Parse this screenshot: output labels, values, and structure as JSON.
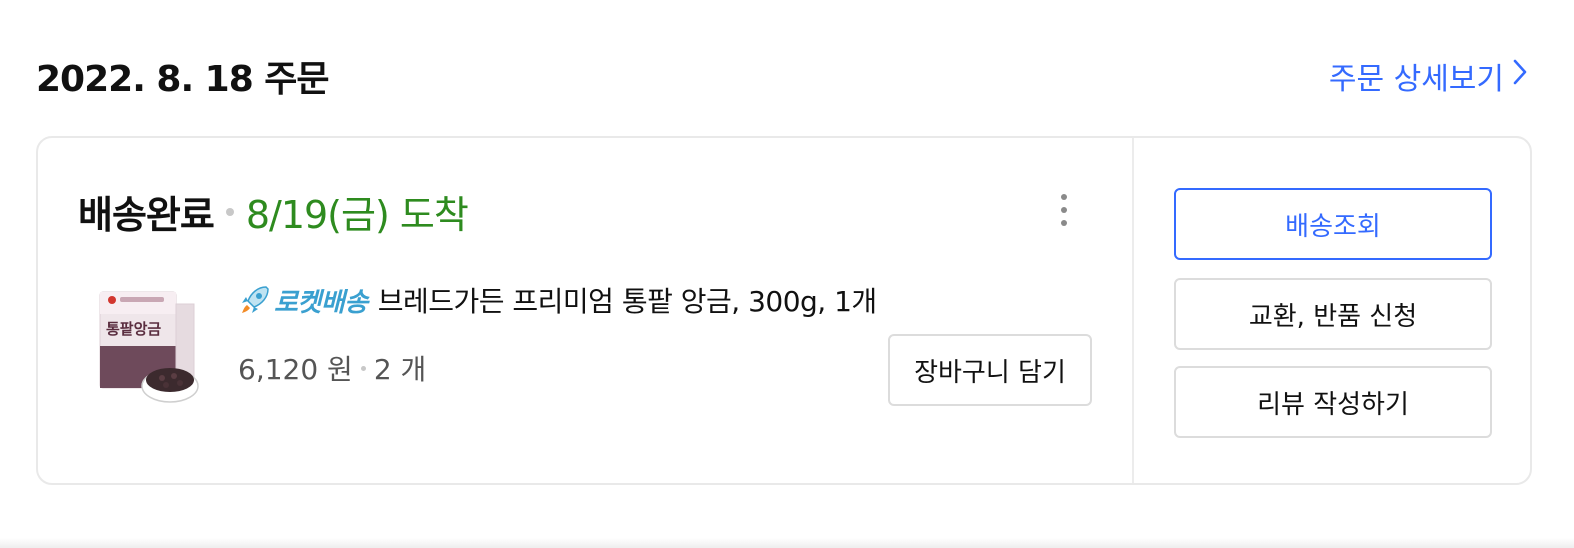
{
  "order": {
    "date_label": "2022. 8. 18 주문",
    "detail_link_label": "주문 상세보기"
  },
  "shipment": {
    "status": "배송완료",
    "arrival": "8/19(금) 도착"
  },
  "product": {
    "badge": "로켓배송",
    "name": "브레드가든 프리미엄 통팥 앙금, 300g, 1개",
    "price": "6,120 원",
    "quantity": "2 개",
    "thumbnail_text": "통팥앙금"
  },
  "buttons": {
    "add_to_cart": "장바구니 담기",
    "track_delivery": "배송조회",
    "exchange_return": "교환, 반품 신청",
    "write_review": "리뷰 작성하기"
  },
  "colors": {
    "accent_blue": "#346aff",
    "arrival_green": "#2e8b1f",
    "rocket_blue": "#3aa0d0"
  },
  "icons": {
    "more": "more-vertical-icon",
    "chevron": "chevron-right-icon",
    "rocket": "rocket-icon"
  }
}
